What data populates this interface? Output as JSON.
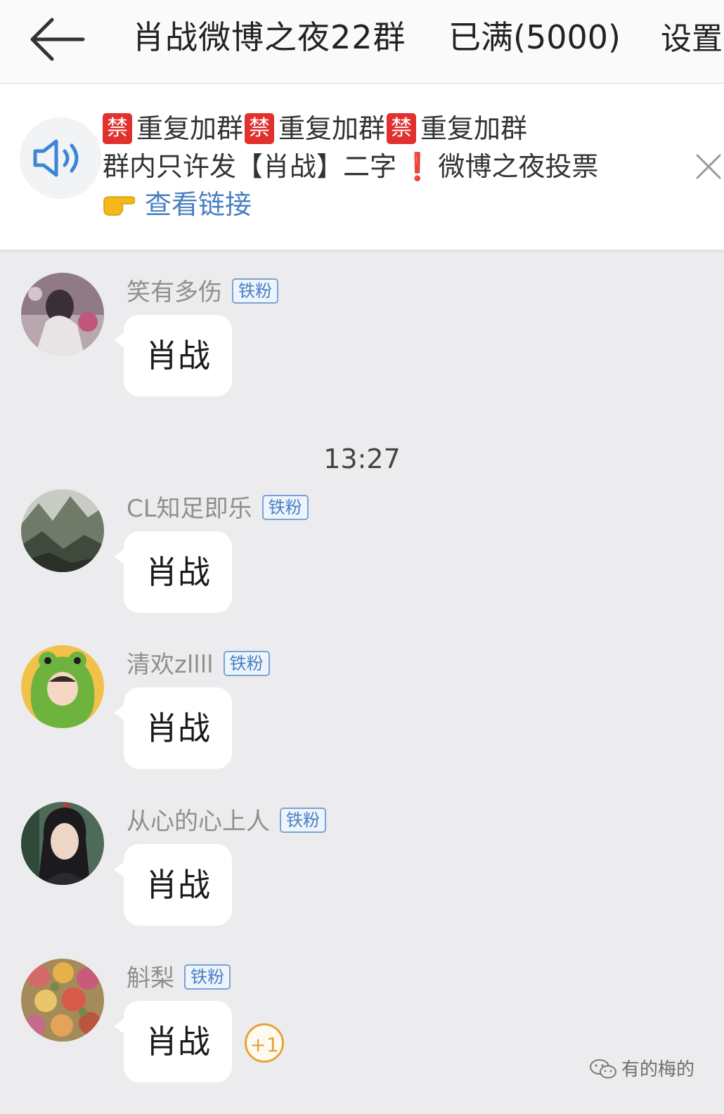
{
  "header": {
    "title": "肖战微博之夜22群",
    "member_status": "已满(5000)",
    "settings_label": "设置",
    "back_icon": "back-arrow-icon"
  },
  "notice": {
    "icon": "speaker-icon",
    "ban_badge": "禁",
    "ban_text": "重复加群",
    "line2_part1": "群内只许发【肖战】二字",
    "line2_exclaim": "❗",
    "line2_part2": "微博之夜投票",
    "link_text": "查看链接",
    "close_icon": "close-icon"
  },
  "time_separator": "13:27",
  "messages": [
    {
      "sender": "笑有多伤",
      "badge": "铁粉",
      "text": "肖战"
    },
    {
      "sender": "CL知足即乐",
      "badge": "铁粉",
      "text": "肖战"
    },
    {
      "sender": "清欢zllll",
      "badge": "铁粉",
      "text": "肖战"
    },
    {
      "sender": "从心的心上人",
      "badge": "铁粉",
      "text": "肖战"
    },
    {
      "sender": "斛梨",
      "badge": "铁粉",
      "text": "肖战",
      "plus_one": "+1"
    }
  ],
  "watermark": "有的梅的",
  "colors": {
    "ban_red": "#e0312f",
    "link_blue": "#4a7fc1",
    "plus_one_orange": "#e8a23a",
    "background": "#ececee"
  }
}
